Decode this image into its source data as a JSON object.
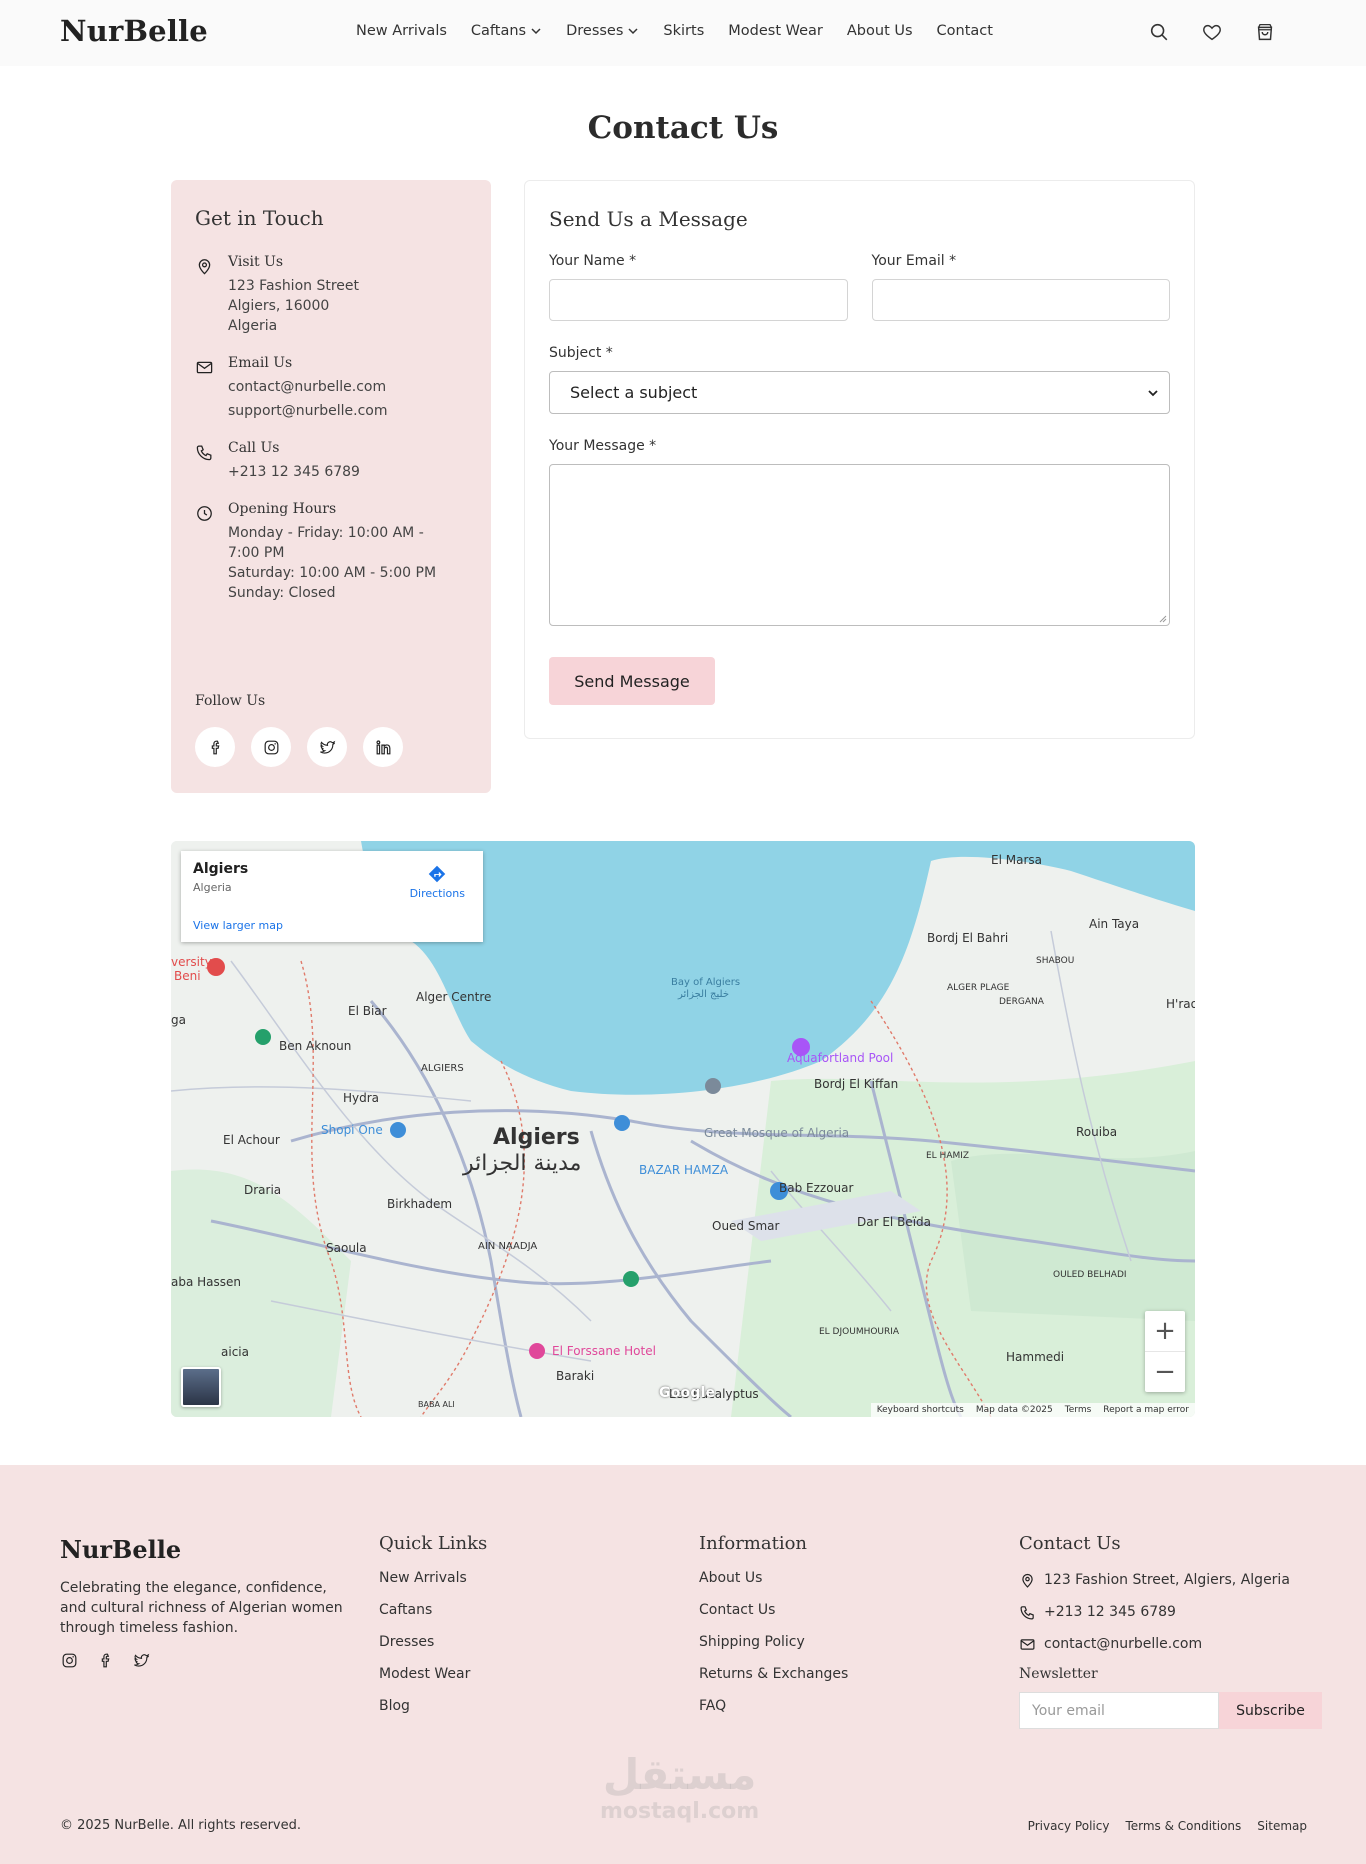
{
  "header": {
    "logo": "NurBelle",
    "nav": [
      {
        "label": "New Arrivals",
        "dropdown": false
      },
      {
        "label": "Caftans",
        "dropdown": true
      },
      {
        "label": "Dresses",
        "dropdown": true
      },
      {
        "label": "Skirts",
        "dropdown": false
      },
      {
        "label": "Modest Wear",
        "dropdown": false
      },
      {
        "label": "About Us",
        "dropdown": false
      },
      {
        "label": "Contact",
        "dropdown": false
      }
    ],
    "icons": [
      "search-icon",
      "heart-icon",
      "cart-icon"
    ]
  },
  "page": {
    "title": "Contact Us"
  },
  "info": {
    "title": "Get in Touch",
    "visit": {
      "title": "Visit Us",
      "lines": [
        "123 Fashion Street",
        "Algiers, 16000",
        "Algeria"
      ]
    },
    "email": {
      "title": "Email Us",
      "lines": [
        "contact@nurbelle.com",
        "support@nurbelle.com"
      ]
    },
    "call": {
      "title": "Call Us",
      "lines": [
        "+213 12 345 6789"
      ]
    },
    "hours": {
      "title": "Opening Hours",
      "lines": [
        "Monday - Friday: 10:00 AM - 7:00 PM",
        "Saturday: 10:00 AM - 5:00 PM",
        "Sunday: Closed"
      ]
    },
    "follow": "Follow Us",
    "socials": [
      "facebook-icon",
      "instagram-icon",
      "twitter-icon",
      "linkedin-icon"
    ]
  },
  "form": {
    "title": "Send Us a Message",
    "name_label": "Your Name *",
    "name_value": "",
    "email_label": "Your Email *",
    "email_value": "",
    "subject_label": "Subject *",
    "subject_selected": "Select a subject",
    "message_label": "Your Message *",
    "message_value": "",
    "submit": "Send Message"
  },
  "map": {
    "place_name": "Algiers",
    "place_region": "Algeria",
    "directions": "Directions",
    "larger": "View larger map",
    "google": "Google",
    "footer_links": [
      "Keyboard shortcuts",
      "Map data ©2025",
      "Terms",
      "Report a map error"
    ],
    "labels": {
      "city": "Algiers",
      "city_ar": "مدينة الجزائر",
      "bay": "Bay of Algiers",
      "bay_ar": "خليج الجزائر",
      "alger_centre": "Alger Centre",
      "el_biar": "El Biar",
      "ben_aknoun": "Ben Aknoun",
      "hydra": "Hydra",
      "shopi_one": "Shopi One",
      "el_achour": "El Achour",
      "draria": "Draria",
      "birkhadem": "Birkhadem",
      "saoula": "Saoula",
      "ain_naadja": "AIN NAADJA",
      "baba_hassen": "aba Hassen",
      "baraki": "Baraki",
      "les_eucalyptus": "Les Eucalyptus",
      "el_forssane": "El Forssane Hotel",
      "oued_smar": "Oued Smar",
      "bab_ezzouar": "Bab Ezzouar",
      "dar_el_beida": "Dar El Beïda",
      "bordj_el_kiffan": "Bordj El Kiffan",
      "great_mosque": "Great Mosque of Algeria",
      "bazar_hamza": "BAZAR HAMZA",
      "aquafortland": "Aquafortland Pool",
      "bordj_el_bahri": "Bordj El Bahri",
      "el_marsa": "El Marsa",
      "ain_taya": "Ain Taya",
      "rouiba": "Rouiba",
      "hammedi": "Hammedi",
      "algiers_small": "ALGIERS",
      "el_hamiz": "EL HAMIZ",
      "shabou": "SHABOU",
      "alger_plage": "ALGER PLAGE",
      "dergana": "DERGANA",
      "el_djoumhouria": "EL DJOUMHOURIA",
      "ouled_belhadi": "OULED BELHADI",
      "baba_ali": "BABA ALI",
      "raicia": "aicia",
      "hraoua": "H'rao",
      "university": "versity",
      "beni": "Beni",
      "ga": "ga"
    }
  },
  "footer": {
    "logo": "NurBelle",
    "about": "Celebrating the elegance, confidence, and cultural richness of Algerian women through timeless fashion.",
    "socials": [
      "instagram-icon",
      "facebook-icon",
      "twitter-icon"
    ],
    "quick": {
      "title": "Quick Links",
      "links": [
        "New Arrivals",
        "Caftans",
        "Dresses",
        "Modest Wear",
        "Blog"
      ]
    },
    "info": {
      "title": "Information",
      "links": [
        "About Us",
        "Contact Us",
        "Shipping Policy",
        "Returns & Exchanges",
        "FAQ"
      ]
    },
    "contact": {
      "title": "Contact Us",
      "address": "123 Fashion Street, Algiers, Algeria",
      "phone": "+213 12 345 6789",
      "email": "contact@nurbelle.com"
    },
    "newsletter": {
      "label": "Newsletter",
      "placeholder": "Your email",
      "button": "Subscribe"
    },
    "copyright": "© 2025 NurBelle. All rights reserved.",
    "legal": [
      "Privacy Policy",
      "Terms & Conditions",
      "Sitemap"
    ],
    "watermark": "مستقل",
    "watermark_latin": "mostaql.com"
  }
}
